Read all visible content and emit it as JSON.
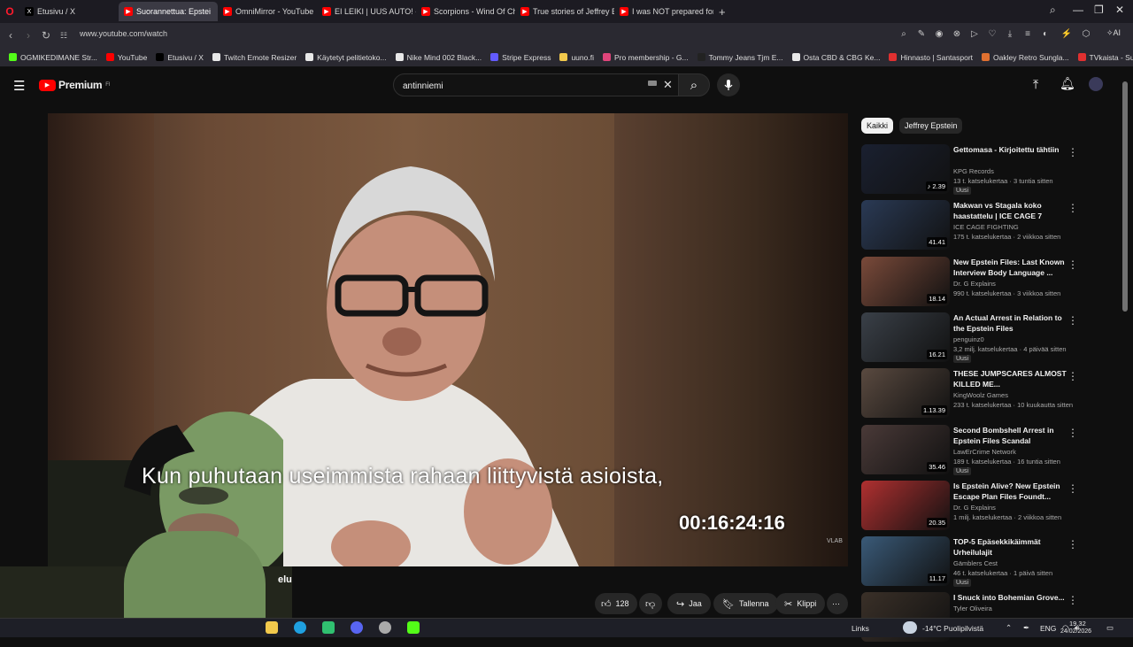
{
  "browser": {
    "tabs": [
      {
        "label": "Etusivu / X",
        "color": "#000000",
        "glyph": "X"
      },
      {
        "label": "Suorannettua: Epstei",
        "color": "#ff0000",
        "glyph": "▶"
      },
      {
        "label": "OmniMirror - YouTube",
        "color": "#ff0000",
        "glyph": "▶"
      },
      {
        "label": "EI LEIKI | UUS AUTO! - You",
        "color": "#ff0000",
        "glyph": "▶"
      },
      {
        "label": "Scorpions - Wind Of Chan",
        "color": "#ff0000",
        "glyph": "▶"
      },
      {
        "label": "True stories of Jeffrey Epst",
        "color": "#ff0000",
        "glyph": "▶"
      },
      {
        "label": "I was NOT prepared for th",
        "color": "#ff0000",
        "glyph": "▶"
      }
    ],
    "url": "www.youtube.com/watch",
    "ai_label": "AI",
    "bookmarks": [
      {
        "label": "OGMIKEDIMANE Str...",
        "color": "#53fc18"
      },
      {
        "label": "YouTube",
        "color": "#ff0000"
      },
      {
        "label": "Etusivu / X",
        "color": "#000000"
      },
      {
        "label": "Twitch Emote Resizer",
        "color": "#e8e8e8"
      },
      {
        "label": "Käytetyt pelitietoko...",
        "color": "#e8e8e8"
      },
      {
        "label": "Nike Mind 002 Black...",
        "color": "#e8e8e8"
      },
      {
        "label": "Stripe Express",
        "color": "#635bff"
      },
      {
        "label": "uuno.fi",
        "color": "#f2c94c"
      },
      {
        "label": "Pro membership - G...",
        "color": "#e0457b"
      },
      {
        "label": "Tommy Jeans Tjm E...",
        "color": "#222222"
      },
      {
        "label": "Osta CBD & CBG Ke...",
        "color": "#e8e8e8"
      },
      {
        "label": "Hinnasto | Santasport",
        "color": "#e03030"
      },
      {
        "label": "Oakley Retro Sungla...",
        "color": "#e07030"
      },
      {
        "label": "TVkaista - Sub Suora",
        "color": "#e03030"
      }
    ]
  },
  "youtube": {
    "logo": "Premium",
    "logo_sup": "FI",
    "search_value": "antinniemi",
    "video": {
      "subtitle": "Kun puhutaan useimmista rahaan liittyvistä asioista,",
      "timecode": "00:16:24:16",
      "watermark": "VLAB",
      "overlay_text": "elu"
    },
    "actions": {
      "likes": "128",
      "share": "Jaa",
      "save": "Tallenna",
      "clip": "Klippi"
    },
    "chips": [
      "Kaikki",
      "Jeffrey Epstein"
    ],
    "recommendations": [
      {
        "title": "Gettomasa - Kirjoitettu tähtiin",
        "channel": "KPG Records",
        "meta": "13 t. katselukertaa · 3 tuntia sitten",
        "badge": "Uusi",
        "duration": "♪ 2.39",
        "thumb": "#1a2030"
      },
      {
        "title": "Makwan vs Stagala koko haastattelu | ICE CAGE 7",
        "channel": "ICE CAGE FIGHTING",
        "meta": "175 t. katselukertaa · 2 viikkoa sitten",
        "badge": "",
        "duration": "41.41",
        "thumb": "#2a3a55"
      },
      {
        "title": "New Epstein Files: Last Known Interview Body Language ...",
        "channel": "Dr. G Explains",
        "meta": "990 t. katselukertaa · 3 viikkoa sitten",
        "badge": "",
        "duration": "18.14",
        "thumb": "#7a4a3a"
      },
      {
        "title": "An Actual Arrest in Relation to the Epstein Files",
        "channel": "penguinz0",
        "meta": "3,2 milj. katselukertaa · 4 päivää sitten",
        "badge": "Uusi",
        "duration": "16.21",
        "thumb": "#3a4048"
      },
      {
        "title": "THESE JUMPSCARES ALMOST KILLED ME...",
        "channel": "KingWoolz Games",
        "meta": "233 t. katselukertaa · 10 kuukautta sitten",
        "badge": "",
        "duration": "1.13.39",
        "thumb": "#5a4a40"
      },
      {
        "title": "Second Bombshell Arrest in Epstein Files Scandal",
        "channel": "LawErCrime Network",
        "meta": "189 t. katselukertaa · 16 tuntia sitten",
        "badge": "Uusi",
        "duration": "35.46",
        "thumb": "#4a3a38"
      },
      {
        "title": "Is Epstein Alive? New Epstein Escape Plan Files Foundt...",
        "channel": "Dr. G Explains",
        "meta": "1 milj. katselukertaa · 2 viikkoa sitten",
        "badge": "",
        "duration": "20.35",
        "thumb": "#b03030"
      },
      {
        "title": "TOP-5 Epäsekkikäimmät Urheilulajit",
        "channel": "Gämblers Cest",
        "meta": "46 t. katselukertaa · 1 päivä sitten",
        "badge": "Uusi",
        "duration": "11.17",
        "thumb": "#3a5a78"
      },
      {
        "title": "I Snuck into Bohemian Grove...",
        "channel": "Tyler Oliveira",
        "meta": "",
        "badge": "",
        "duration": "",
        "thumb": "#3a3028"
      }
    ]
  },
  "taskbar": {
    "links_label": "Links",
    "weather": "-14°C  Puolipilvistä",
    "lang": "ENG",
    "time": "19.32",
    "date": "24/02/2026"
  }
}
